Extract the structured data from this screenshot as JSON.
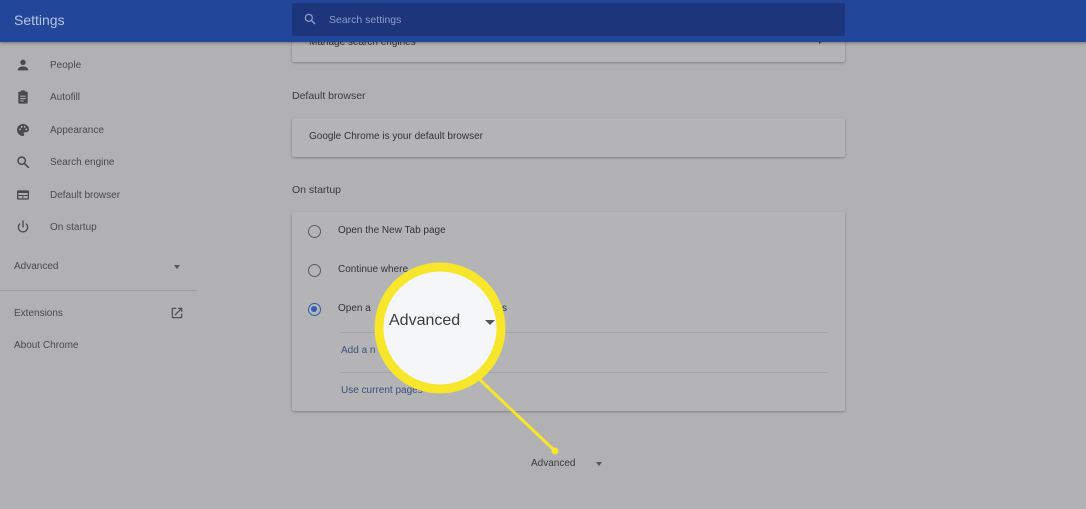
{
  "header": {
    "title": "Settings",
    "search_placeholder": "Search settings",
    "search_value": ""
  },
  "sidebar": {
    "items": [
      {
        "label": "People",
        "icon": "person-icon"
      },
      {
        "label": "Autofill",
        "icon": "clipboard-icon"
      },
      {
        "label": "Appearance",
        "icon": "palette-icon"
      },
      {
        "label": "Search engine",
        "icon": "search-icon"
      },
      {
        "label": "Default browser",
        "icon": "browser-window-icon"
      },
      {
        "label": "On startup",
        "icon": "power-icon"
      }
    ],
    "advanced_label": "Advanced",
    "extensions_label": "Extensions",
    "about_label": "About Chrome"
  },
  "main": {
    "search_engine_card": {
      "manage_label": "Manage search engines"
    },
    "default_browser": {
      "title": "Default browser",
      "status": "Google Chrome is your default browser"
    },
    "on_startup": {
      "title": "On startup",
      "options": [
        {
          "label": "Open the New Tab page",
          "checked": false
        },
        {
          "label": "Continue where you left off",
          "checked": false
        },
        {
          "label": "Open a specific page or set of pages",
          "checked": true
        }
      ],
      "visible_labels": [
        "Open the New Tab page",
        "Continue where",
        "Open a",
        "s"
      ],
      "add_page_label": "Add a new page",
      "add_page_visible": "Add a n",
      "use_current_label": "Use current pages",
      "use_current_visible": "Use current pages"
    },
    "advanced_label": "Advanced"
  },
  "callout": {
    "label": "Advanced",
    "ring_color": "#f7e629",
    "fill_color": "#f5f6f8"
  },
  "colors": {
    "header": "#22479a",
    "search_box": "#1d357a",
    "background": "#b1b1b3",
    "radio_accent": "#2e5db6",
    "link": "#3c4f7c"
  }
}
